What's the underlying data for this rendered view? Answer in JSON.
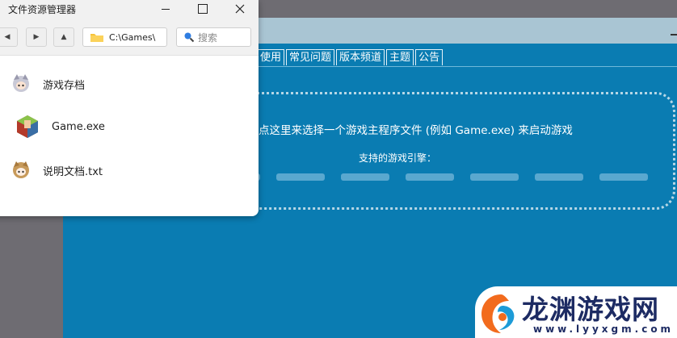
{
  "app": {
    "tabs": [
      "使用",
      "常见问题",
      "版本频道",
      "主题",
      "公告"
    ],
    "drop_text": "点这里来选择一个游戏主程序文件 (例如 Game.exe) 来启动游戏",
    "engines_label": "支持的游戏引擎："
  },
  "explorer": {
    "title": "文件资源管理器",
    "address": "C:\\Games\\",
    "search_placeholder": "搜索",
    "files": [
      {
        "name": "游戏存档",
        "icon": "anime-avatar-icon"
      },
      {
        "name": "Game.exe",
        "icon": "game-exe-icon"
      },
      {
        "name": "说明文档.txt",
        "icon": "anime-avatar-icon"
      }
    ]
  },
  "watermark": {
    "title": "龙渊游戏网",
    "url": "www.lyyxgm.com"
  },
  "colors": {
    "app_background": "#0a7cb2",
    "app_titlebar": "#a9c5d3",
    "desktop": "#6e6c72",
    "watermark_text": "#1d2b63",
    "watermark_orange": "#f26b1d"
  }
}
